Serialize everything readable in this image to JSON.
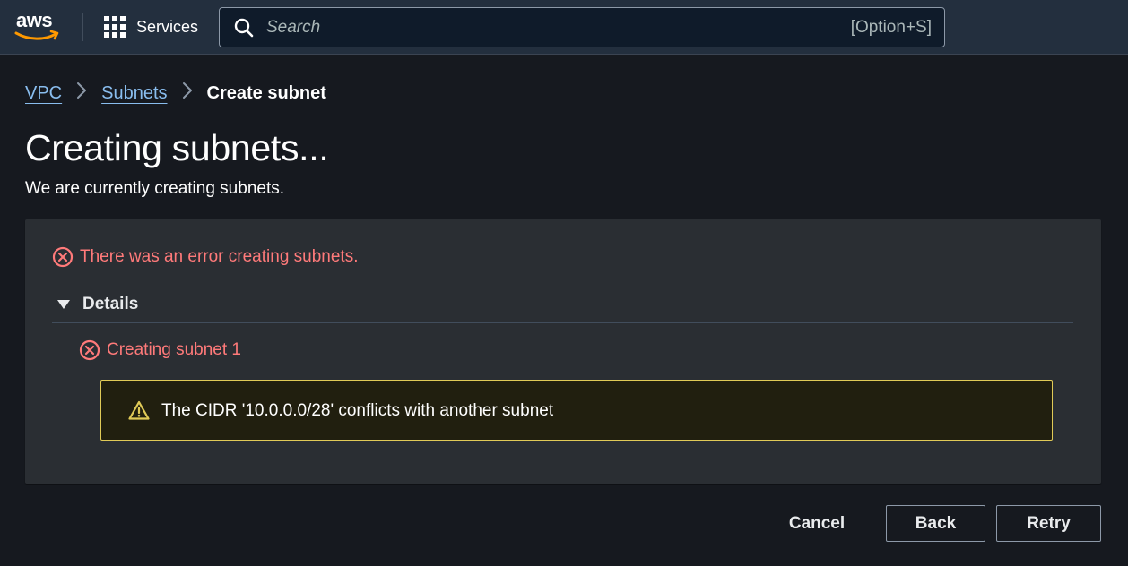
{
  "header": {
    "logo_text": "aws",
    "services_label": "Services",
    "search": {
      "placeholder": "Search",
      "shortcut": "[Option+S]"
    }
  },
  "breadcrumb": [
    {
      "label": "VPC",
      "link": true
    },
    {
      "label": "Subnets",
      "link": true
    },
    {
      "label": "Create subnet",
      "link": false
    }
  ],
  "page": {
    "title": "Creating subnets...",
    "subtitle": "We are currently creating subnets."
  },
  "status": {
    "error_message": "There was an error creating subnets.",
    "details_label": "Details",
    "details_expanded": true,
    "items": [
      {
        "label": "Creating subnet 1",
        "state": "error",
        "warning": "The CIDR '10.0.0.0/28' conflicts with another subnet"
      }
    ]
  },
  "actions": {
    "cancel_label": "Cancel",
    "back_label": "Back",
    "retry_label": "Retry"
  },
  "colors": {
    "error": "#ff7a7a",
    "warning_border": "#e0ca57",
    "link": "#89bdee",
    "background": "#16191f",
    "header": "#232f3e",
    "panel": "#2a2e33"
  },
  "icons": {
    "logo": "aws-logo-icon",
    "services": "grid-icon",
    "search": "search-icon",
    "breadcrumb_separator": "chevron-right-icon",
    "error": "x-circle-icon",
    "details_toggle": "caret-down-icon",
    "warning": "warning-triangle-icon"
  }
}
